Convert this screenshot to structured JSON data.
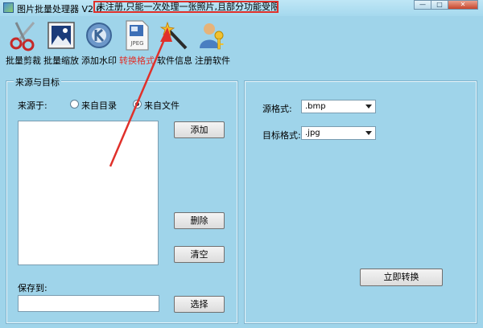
{
  "window": {
    "title": "图片批量处理器 V2.0",
    "notice": "未注册,只能一次处理一张照片,且部分功能受限!",
    "controls": [
      "—",
      "□",
      "✕"
    ]
  },
  "toolbar": [
    {
      "label": "批量剪裁",
      "icon": "scissors-icon"
    },
    {
      "label": "批量缩放",
      "icon": "photo-frame-icon"
    },
    {
      "label": "添加水印",
      "icon": "kde-logo-icon"
    },
    {
      "label": "转换格式",
      "icon": "jpeg-file-icon",
      "active": true
    },
    {
      "label": "软件信息",
      "icon": "magic-wand-icon"
    },
    {
      "label": "注册软件",
      "icon": "user-key-icon"
    }
  ],
  "source_panel": {
    "title": "来源与目标",
    "source_label": "来源于:",
    "radio_dir": "来自目录",
    "radio_file": "来自文件",
    "selected": "file",
    "add_label": "添加",
    "delete_label": "删除",
    "clear_label": "清空",
    "save_label": "保存到:",
    "save_value": "",
    "choose_label": "选择"
  },
  "convert_panel": {
    "source_format_label": "源格式:",
    "source_format": ".bmp",
    "target_format_label": "目标格式:",
    "target_format": ".jpg",
    "convert_label": "立即转换"
  },
  "colors": {
    "accent": "#e0302a",
    "background": "#9fd4ea"
  }
}
